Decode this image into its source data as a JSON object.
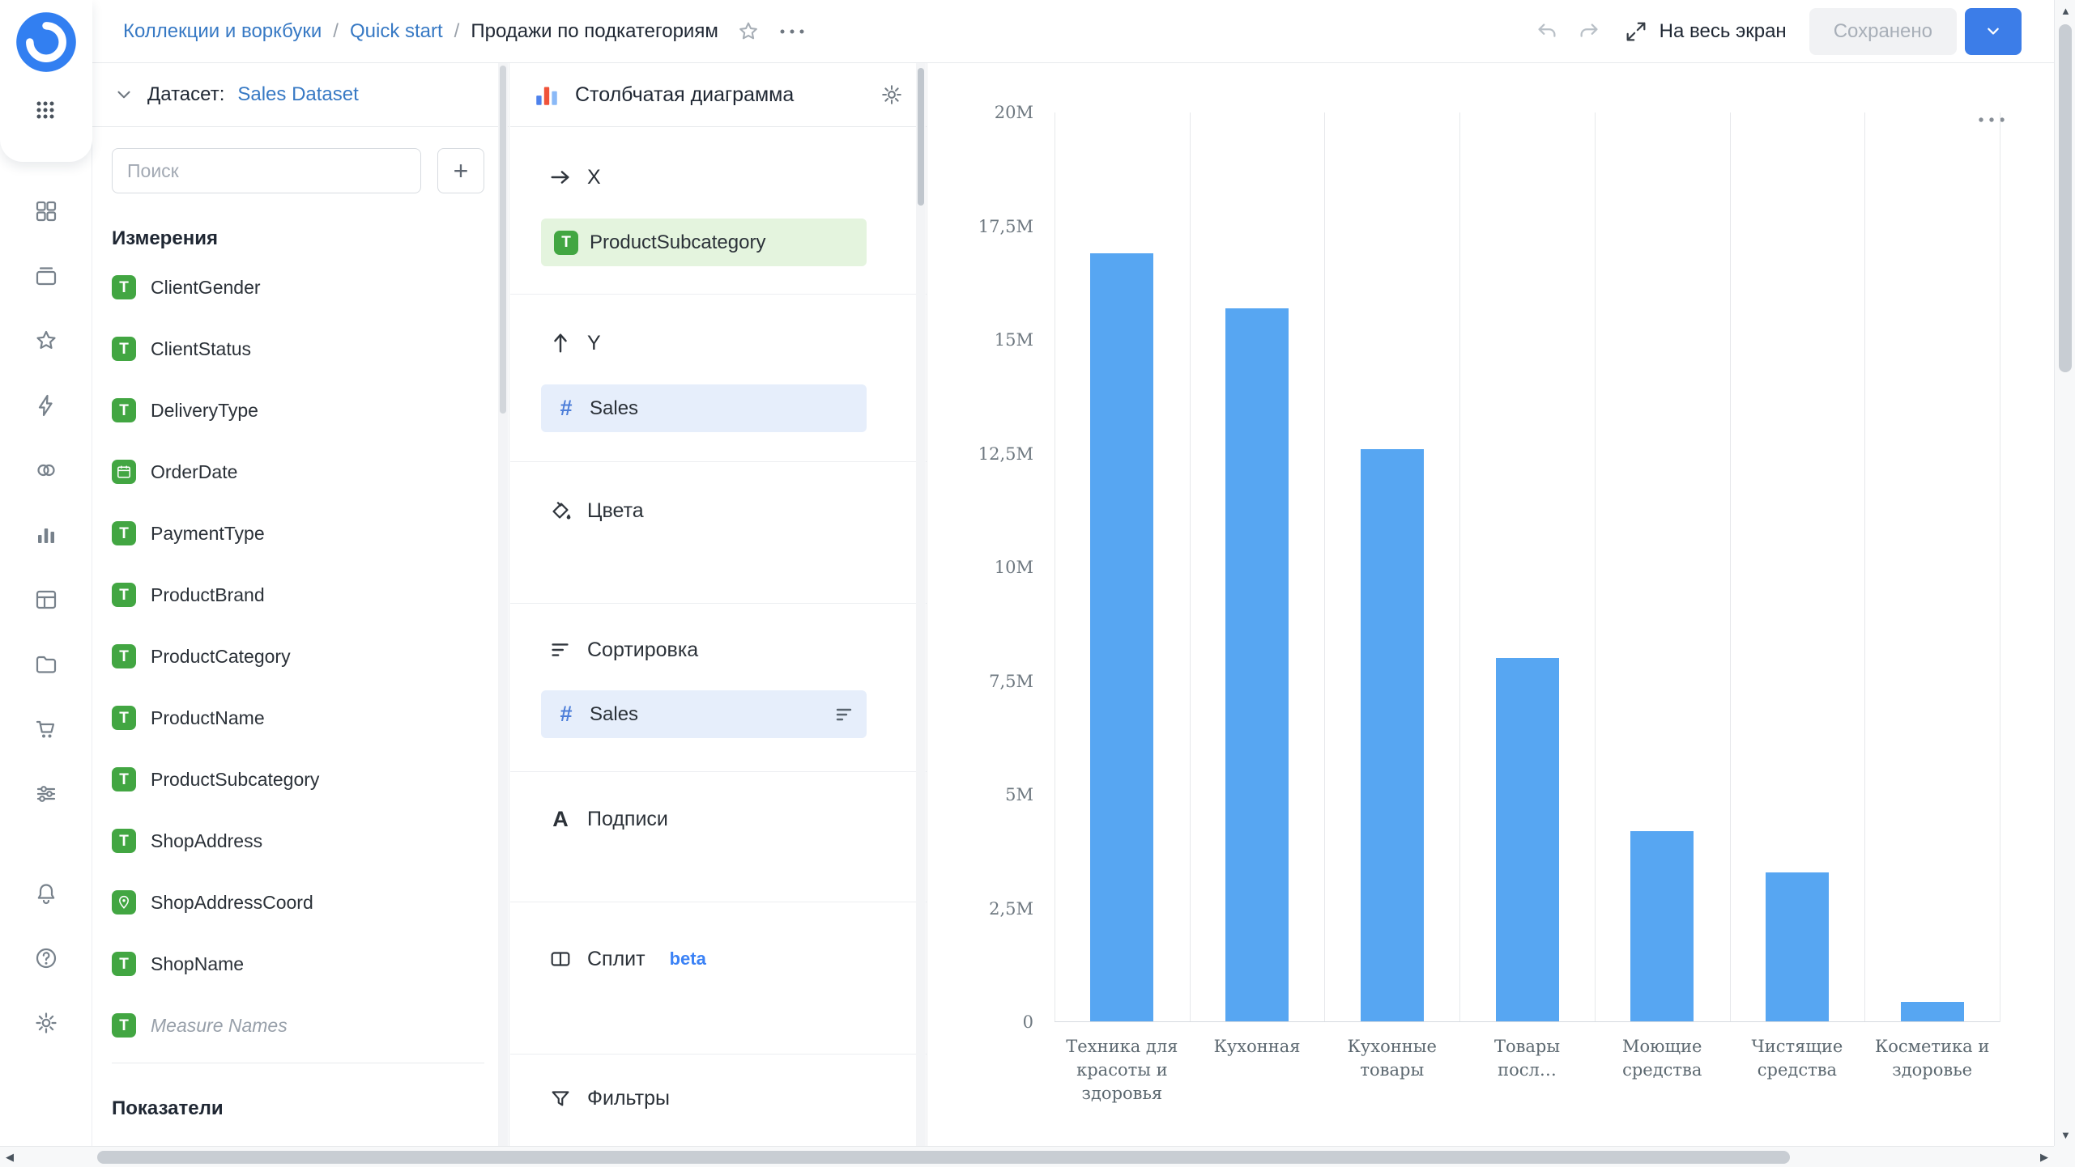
{
  "topbar": {
    "breadcrumbs": [
      "Коллекции и воркбуки",
      "Quick start",
      "Продажи по подкатегориям"
    ],
    "separator": "/",
    "fullscreen_label": "На весь экран",
    "saved_button_label": "Сохранено"
  },
  "dataset_panel": {
    "label": "Датасет:",
    "dataset_name": "Sales Dataset",
    "search_placeholder": "Поиск",
    "dimensions_title": "Измерения",
    "measures_title": "Показатели",
    "fields": [
      {
        "name": "ClientGender",
        "type": "string"
      },
      {
        "name": "ClientStatus",
        "type": "string"
      },
      {
        "name": "DeliveryType",
        "type": "string"
      },
      {
        "name": "OrderDate",
        "type": "date"
      },
      {
        "name": "PaymentType",
        "type": "string"
      },
      {
        "name": "ProductBrand",
        "type": "string"
      },
      {
        "name": "ProductCategory",
        "type": "string"
      },
      {
        "name": "ProductName",
        "type": "string"
      },
      {
        "name": "ProductSubcategory",
        "type": "string"
      },
      {
        "name": "ShopAddress",
        "type": "string"
      },
      {
        "name": "ShopAddressCoord",
        "type": "geo"
      },
      {
        "name": "ShopName",
        "type": "string"
      },
      {
        "name": "Measure Names",
        "type": "string",
        "muted": true
      }
    ]
  },
  "config_panel": {
    "chart_type_label": "Столбчатая диаграмма",
    "x_section": {
      "label": "X",
      "field": "ProductSubcategory"
    },
    "y_section": {
      "label": "Y",
      "field": "Sales"
    },
    "colors_section": {
      "label": "Цвета"
    },
    "sort_section": {
      "label": "Сортировка",
      "field": "Sales"
    },
    "labels_section": {
      "label": "Подписи"
    },
    "split_section": {
      "label": "Сплит",
      "badge": "beta"
    },
    "filters_section": {
      "label": "Фильтры"
    }
  },
  "chart_data": {
    "type": "bar",
    "title": "",
    "categories": [
      "Техника для красоты и здоровья",
      "Кухонная",
      "Кухонные товары",
      "Товары посл…",
      "Моющие средства",
      "Чистящие средства",
      "Косметика и здоровье"
    ],
    "values": [
      16.9,
      15.7,
      12.6,
      8.0,
      4.2,
      3.3,
      0.45
    ],
    "value_unit": "M",
    "ylim": [
      0,
      20
    ],
    "y_ticks": [
      "0",
      "2,5M",
      "5M",
      "7,5M",
      "10M",
      "12,5M",
      "15M",
      "17,5M",
      "20M"
    ],
    "grid": "vertical",
    "legend": "none",
    "bar_color": "#57A6F2"
  },
  "icons": {
    "string_field_glyph": "T",
    "number_field_glyph": "#",
    "labels_glyph": "A",
    "add_glyph": "+"
  },
  "colors": {
    "accent_blue": "#3C7DE8",
    "link_blue": "#3779C4",
    "field_green": "#42A642",
    "chip_green_bg": "#E4F4DE",
    "chip_blue_bg": "#E6EEFB",
    "bar_blue": "#57A6F2"
  }
}
